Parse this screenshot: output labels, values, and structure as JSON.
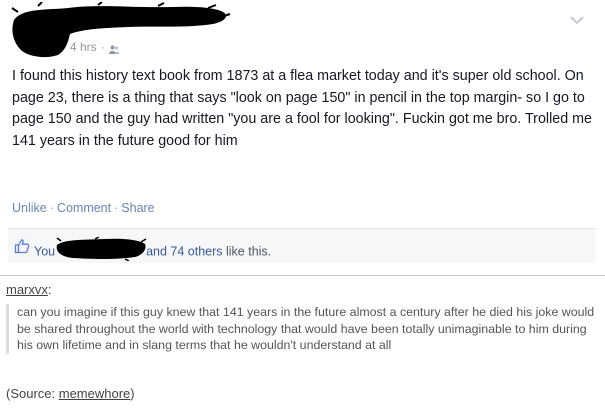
{
  "post": {
    "timestamp": "4 hrs",
    "privacy_icon": "people-icon",
    "body": "I found this history text book from 1873 at a flea market today and it's super old school. On page 23, there is a thing that says \"look on page 150\" in pencil in the top margin- so I go to page 150 and the guy had written \"you are a fool for looking\". Fuckin got me bro. Trolled me 141 years in the future good for him",
    "actions": {
      "unlike": "Unlike",
      "comment": "Comment",
      "share": "Share",
      "separator": "·"
    },
    "likes": {
      "you": "You",
      "others_link": "and 74 others",
      "suffix": "like this."
    }
  },
  "reblog": {
    "author": "marxvx",
    "author_suffix": ":",
    "quote": "can you imagine if this guy knew that 141 years in the future almost a century after he died his joke would be shared throughout the world with technology that would have been totally unimaginable to him during his own lifetime and in slang terms that he wouldn't understand at all",
    "source_prefix": "(Source: ",
    "source_name": "memewhore",
    "source_suffix": ")"
  },
  "colors": {
    "link": "#3b5998",
    "action": "#6d84b4",
    "meta": "#9197a3",
    "redaction": "#000000"
  }
}
